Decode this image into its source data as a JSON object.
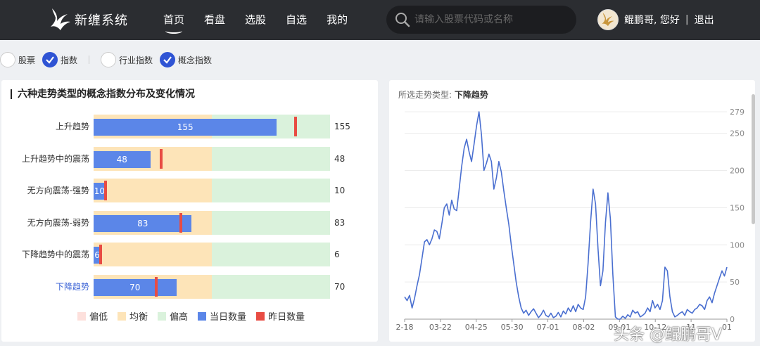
{
  "header": {
    "logo_text": "新缠系统",
    "nav": [
      "首页",
      "看盘",
      "选股",
      "自选",
      "我的"
    ],
    "search_placeholder": "请输入股票代码或名称",
    "greeting": "鲲鹏哥, 您好",
    "separator": "|",
    "logout": "退出"
  },
  "filters": {
    "group1": [
      {
        "label": "股票",
        "checked": false
      },
      {
        "label": "指数",
        "checked": true
      }
    ],
    "group2": [
      {
        "label": "行业指数",
        "checked": false
      },
      {
        "label": "概念指数",
        "checked": true
      }
    ]
  },
  "left_panel": {
    "title": "六种走势类型的概念指数分布及变化情况",
    "legend": [
      {
        "label": "偏低",
        "color": "#fde0dc"
      },
      {
        "label": "均衡",
        "color": "#fde4b8"
      },
      {
        "label": "偏高",
        "color": "#daf2dc"
      },
      {
        "label": "当日数量",
        "color": "#5b86e8"
      },
      {
        "label": "昨日数量",
        "color": "#e84c43"
      }
    ]
  },
  "right_panel": {
    "title_prefix": "所选走势类型:",
    "title_value": "下降趋势"
  },
  "watermark": "头条 @鲲鹏哥V",
  "chart_data": [
    {
      "type": "bar",
      "categories": [
        "上升趋势",
        "上升趋势中的震荡",
        "无方向震荡-强势",
        "无方向震荡-弱势",
        "下降趋势中的震荡",
        "下降趋势"
      ],
      "series": [
        {
          "name": "当日数量",
          "values": [
            155,
            48,
            10,
            83,
            6,
            70
          ]
        },
        {
          "name": "昨日数量",
          "values": [
            171,
            57,
            10,
            74,
            6,
            53
          ]
        }
      ],
      "zones": {
        "偏低": [
          0,
          0
        ],
        "均衡": [
          0,
          100
        ],
        "偏高": [
          100,
          200
        ]
      },
      "value_labels": [
        "155",
        "48",
        "10",
        "83",
        "6",
        "70"
      ],
      "xlim": [
        0,
        200
      ],
      "selected_category": "下降趋势",
      "legend_position": "bottom"
    },
    {
      "type": "line",
      "x_ticks": [
        "2-18",
        "03-22",
        "04-25",
        "05-30",
        "07-01",
        "08-02",
        "09-01",
        "10-12",
        "11",
        "01"
      ],
      "y_ticks": [
        0,
        50,
        100,
        150,
        200,
        250,
        279
      ],
      "ylim": [
        0,
        279
      ],
      "y_axis_side": "right",
      "grid": true,
      "color": "#4a6fd0",
      "values": [
        30,
        25,
        32,
        15,
        28,
        45,
        60,
        82,
        104,
        107,
        100,
        108,
        120,
        118,
        108,
        128,
        150,
        155,
        140,
        160,
        148,
        146,
        175,
        205,
        230,
        242,
        225,
        212,
        235,
        260,
        279,
        248,
        200,
        210,
        222,
        212,
        175,
        190,
        212,
        198,
        173,
        150,
        128,
        100,
        75,
        50,
        30,
        15,
        8,
        12,
        5,
        10,
        14,
        8,
        2,
        6,
        12,
        5,
        3,
        8,
        2,
        4,
        9,
        3,
        11,
        7,
        15,
        10,
        18,
        10,
        20,
        15,
        13,
        30,
        75,
        130,
        175,
        155,
        95,
        45,
        65,
        130,
        170,
        135,
        60,
        3,
        0,
        0,
        4,
        1,
        6,
        3,
        12,
        8,
        10,
        3,
        5,
        8,
        15,
        10,
        25,
        15,
        20,
        13,
        25,
        70,
        65,
        30,
        10,
        3,
        5,
        8,
        10,
        5,
        13,
        10,
        8,
        13,
        15,
        20,
        18,
        13,
        25,
        30,
        22,
        35,
        45,
        55,
        65,
        58,
        70
      ]
    }
  ]
}
